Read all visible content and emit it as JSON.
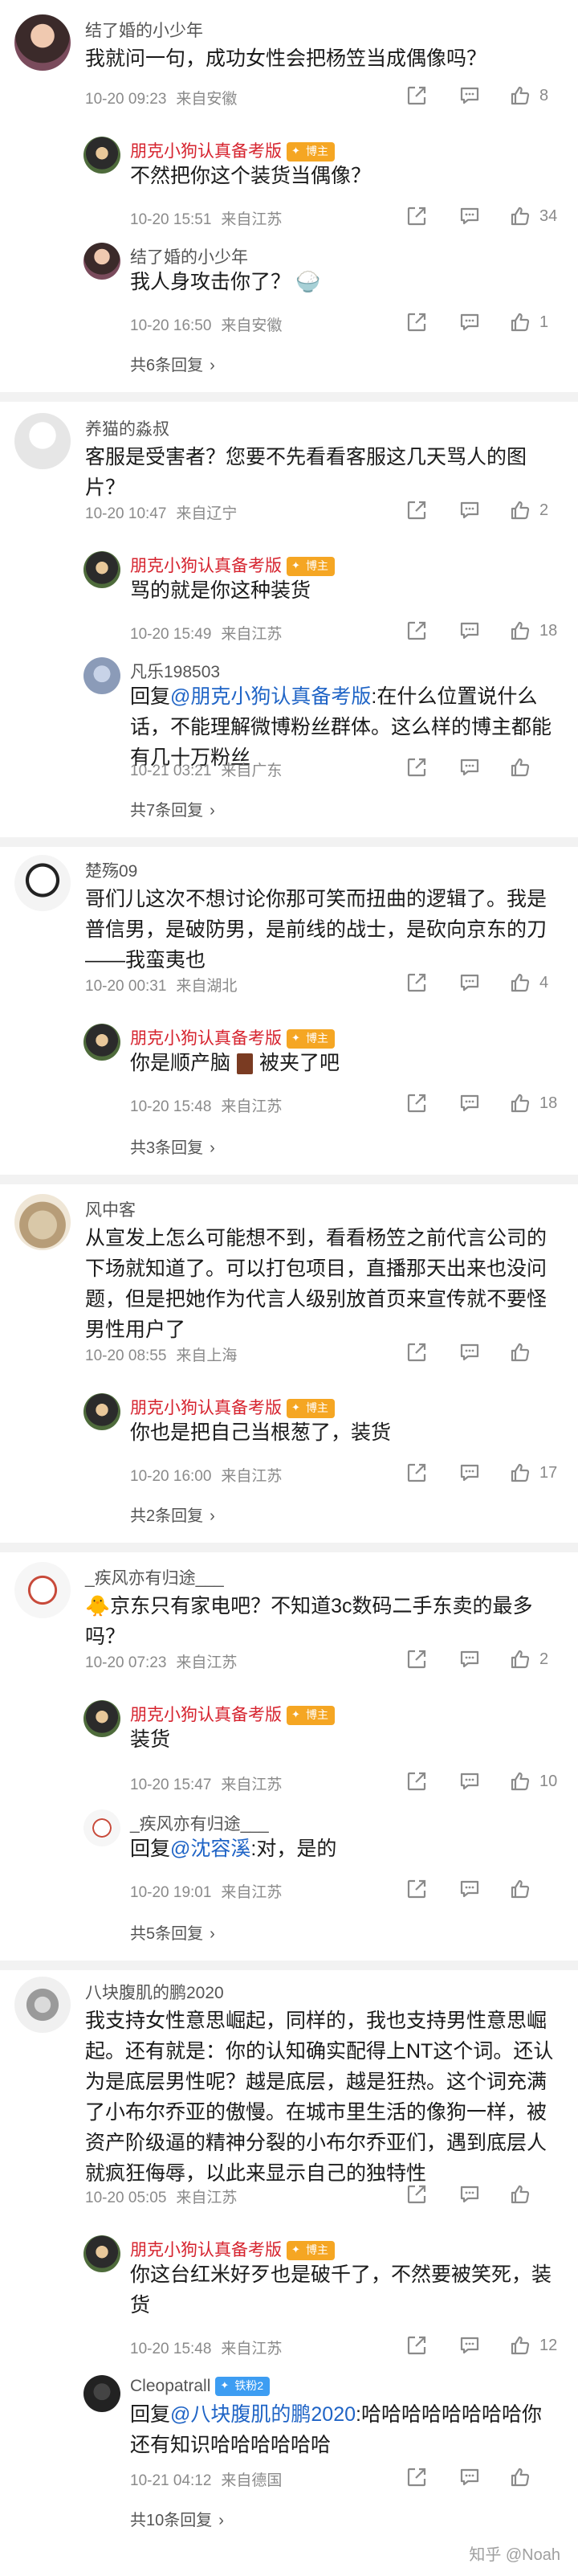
{
  "icons": {
    "share": "share-icon",
    "comment": "comment-bubble-icon",
    "like": "thumbs-up-icon"
  },
  "colors": {
    "author_name": "#d6232e",
    "link": "#1f64c6",
    "badge_orange": "#f5a623",
    "badge_blue": "#3d9df2"
  },
  "comments": [
    {
      "user": "结了婚的小少年",
      "text": "我就问一句，成功女性会把杨笠当成偶像吗？",
      "time": "10-20 09:23",
      "loc": "来自安徽",
      "likes": "8",
      "replies": [
        {
          "user": "朋克小狗认真备考版",
          "badge": "博主",
          "text": "不然把你这个装货当偶像？",
          "time": "10-20 15:51",
          "loc": "来自江苏",
          "likes": "34"
        },
        {
          "user": "结了婚的小少年",
          "text": "我人身攻击你了？",
          "emoji": "🍚",
          "time": "10-20 16:50",
          "loc": "来自安徽",
          "likes": "1"
        }
      ],
      "more": "共6条回复"
    },
    {
      "user": "养猫的淼叔",
      "text": "客服是受害者？您要不先看看客服这几天骂人的图片？",
      "time": "10-20 10:47",
      "loc": "来自辽宁",
      "likes": "2",
      "replies": [
        {
          "user": "朋克小狗认真备考版",
          "badge": "博主",
          "text": "骂的就是你这种装货",
          "time": "10-20 15:49",
          "loc": "来自江苏",
          "likes": "18"
        },
        {
          "user": "凡乐198503",
          "reply_prefix": "回复",
          "reply_to": "@朋克小狗认真备考版",
          "text": ":在什么位置说什么话，不能理解微博粉丝群体。这么样的博主都能有几十万粉丝",
          "time": "10-21 03:21",
          "loc": "来自广东",
          "likes": ""
        }
      ],
      "more": "共7条回复"
    },
    {
      "user": "楚殇09",
      "text": "哥们儿这次不想讨论你那可笑而扭曲的逻辑了。我是普信男，是破防男，是前线的战士，是砍向京东的刀——我蛮夷也",
      "time": "10-20 00:31",
      "loc": "来自湖北",
      "likes": "4",
      "replies": [
        {
          "user": "朋克小狗认真备考版",
          "badge": "博主",
          "text": "你是顺产脑",
          "text_tail": "被夹了吧",
          "time": "10-20 15:48",
          "loc": "来自江苏",
          "likes": "18"
        }
      ],
      "more": "共3条回复"
    },
    {
      "user": "风中客",
      "text": "从宣发上怎么可能想不到，看看杨笠之前代言公司的下场就知道了。可以打包项目，直播那天出来也没问题，但是把她作为代言人级别放首页来宣传就不要怪男性用户了",
      "time": "10-20 08:55",
      "loc": "来自上海",
      "likes": "",
      "replies": [
        {
          "user": "朋克小狗认真备考版",
          "badge": "博主",
          "text": "你也是把自己当根葱了，装货",
          "time": "10-20 16:00",
          "loc": "来自江苏",
          "likes": "17"
        }
      ],
      "more": "共2条回复"
    },
    {
      "user": "_疾风亦有归途___",
      "emoji_lead": "🐥",
      "text": "京东只有家电吧？不知道3c数码二手东卖的最多吗？",
      "time": "10-20 07:23",
      "loc": "来自江苏",
      "likes": "2",
      "replies": [
        {
          "user": "朋克小狗认真备考版",
          "badge": "博主",
          "text": "装货",
          "time": "10-20 15:47",
          "loc": "来自江苏",
          "likes": "10"
        },
        {
          "user": "_疾风亦有归途___",
          "reply_prefix": "回复",
          "reply_to": "@沈容溪",
          "text": ":对，是的",
          "time": "10-20 19:01",
          "loc": "来自江苏",
          "likes": ""
        }
      ],
      "more": "共5条回复"
    },
    {
      "user": "八块腹肌的鹏2020",
      "text": "我支持女性意思崛起，同样的，我也支持男性意思崛起。还有就是：你的认知确实配得上NT这个词。还认为是底层男性呢？越是底层，越是狂热。这个词充满了小布尔乔亚的傲慢。在城市里生活的像狗一样，被资产阶级逼的精神分裂的小布尔乔亚们，遇到底层人就疯狂侮辱，以此来显示自己的独特性",
      "time": "10-20 05:05",
      "loc": "来自江苏",
      "likes": "",
      "replies": [
        {
          "user": "朋克小狗认真备考版",
          "badge": "博主",
          "text": "你这台红米好歹也是破千了，不然要被笑死，装货",
          "time": "10-20 15:48",
          "loc": "来自江苏",
          "likes": "12"
        },
        {
          "user": "Cleopatrall",
          "badge": "铁粉2",
          "reply_prefix": "回复",
          "reply_to": "@八块腹肌的鹏2020",
          "text": ":哈哈哈哈哈哈哈哈你还有知识哈哈哈哈哈哈",
          "time": "10-21 04:12",
          "loc": "来自德国",
          "likes": ""
        }
      ],
      "more": "共10条回复"
    }
  ],
  "watermark": "知乎 @Noah"
}
